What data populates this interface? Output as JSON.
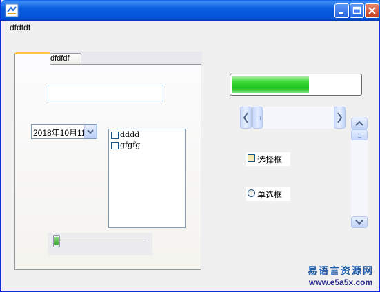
{
  "window": {
    "menu": [
      "dfdfdf"
    ],
    "icons": {
      "app": "app-icon",
      "minimize": "minimize-icon",
      "maximize": "maximize-icon",
      "close": "close-icon"
    }
  },
  "tabs": [
    {
      "label": ""
    },
    {
      "label": "dfdfdf"
    }
  ],
  "form": {
    "text_value": "",
    "date_value": "2018年10月11",
    "list_items": [
      "dddd",
      "gfgfg"
    ],
    "slider_level": 0
  },
  "right": {
    "progress_percent": 60,
    "hscroll_level": 0,
    "vscroll_level": 0,
    "checkbox_label": "选择框",
    "radio_label": "单选框"
  },
  "watermark": {
    "cn": "易语言资源网",
    "url": "www.e5a5x.com"
  },
  "colors": {
    "titlebar": "#0553d6",
    "progress": "#1fc41b",
    "tab_highlight": "#ffc83c"
  }
}
